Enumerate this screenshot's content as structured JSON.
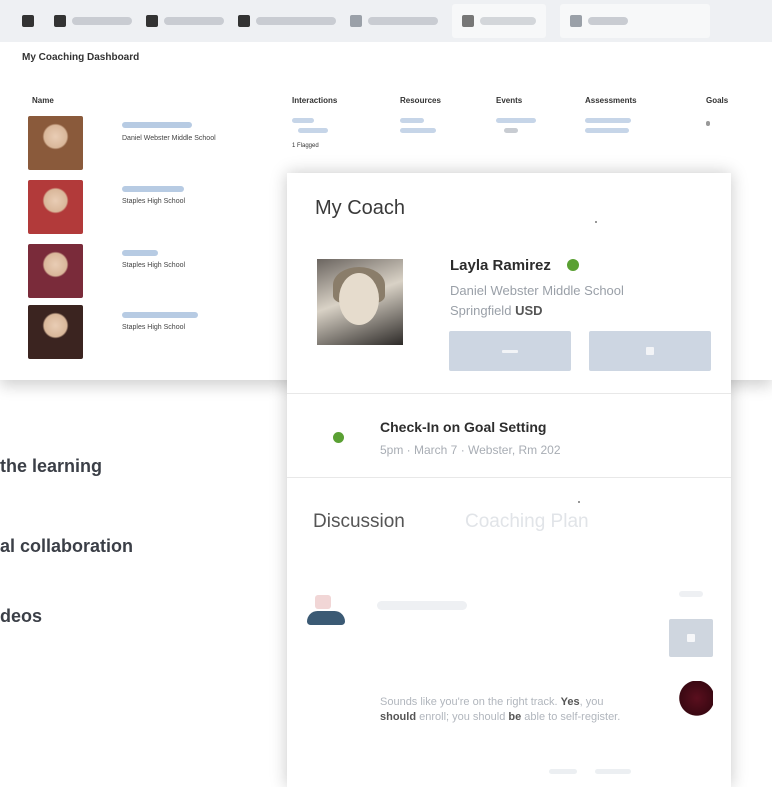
{
  "dashboard": {
    "title": "My Coaching Dashboard",
    "columns": {
      "name": "Name",
      "interactions": "Interactions",
      "resources": "Resources",
      "events": "Events",
      "assessments": "Assessments",
      "goals": "Goals"
    },
    "rows": [
      {
        "school": "Daniel Webster Middle School",
        "flag": "1 Flagged"
      },
      {
        "school": "Staples High School"
      },
      {
        "school": "Staples High School"
      },
      {
        "school": "Staples High School"
      }
    ],
    "avatar_colors": [
      "#8a5a3b",
      "#b23a3a",
      "#7a2b3a",
      "#3b2420"
    ]
  },
  "coach": {
    "title": "My Coach",
    "name": "Layla Ramirez",
    "school": "Daniel Webster Middle School",
    "district_prefix": "Springfield",
    "district_suffix": "USD",
    "status_color": "#5aa033"
  },
  "event": {
    "title": "Check-In on Goal Setting",
    "meta": "5pm · March 7 · Webster, Rm 202"
  },
  "tabs": {
    "discussion": "Discussion",
    "coaching_plan": "Coaching Plan"
  },
  "message": {
    "part1": "Sounds like you're on the right track. ",
    "bold1": "Yes",
    "part2": ", you ",
    "bold2": "should",
    "part3": " enroll; you should ",
    "bold3": "be",
    "part4": " able to self-register."
  },
  "slide": {
    "bullet1": "the learning",
    "bullet2": "al collaboration",
    "bullet3": "deos"
  }
}
